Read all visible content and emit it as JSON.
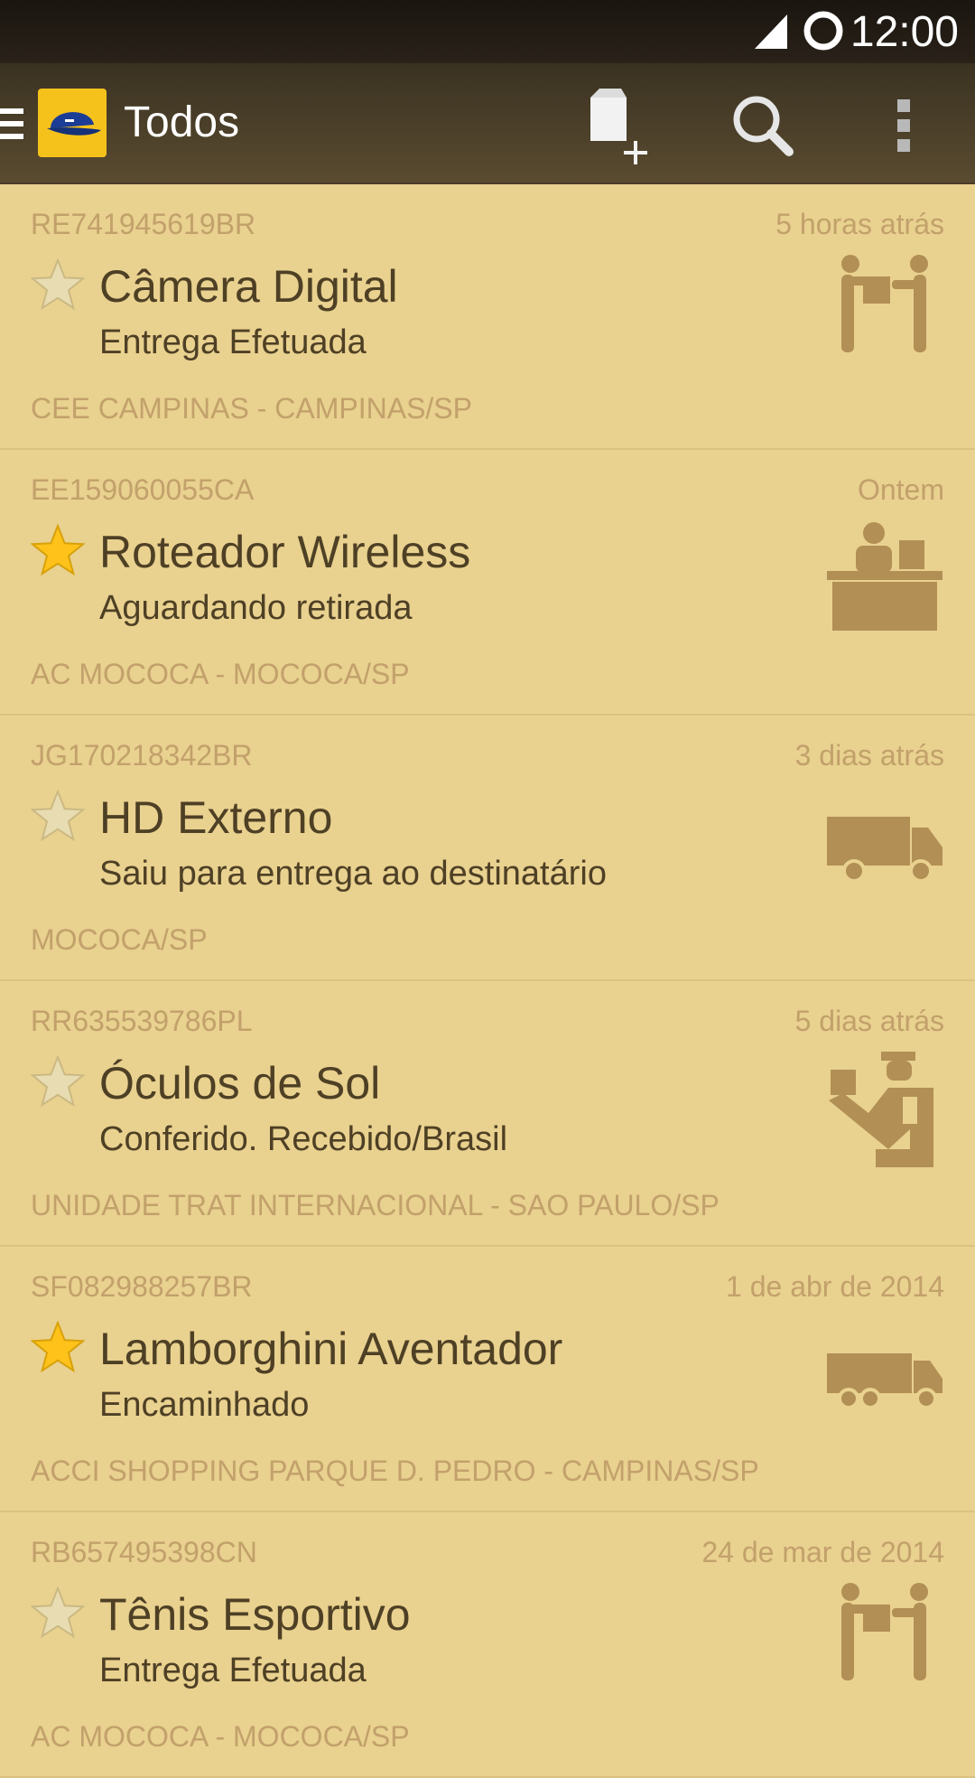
{
  "statusbar": {
    "time": "12:00"
  },
  "actionbar": {
    "title": "Todos",
    "icons": [
      "drawer-icon",
      "app-logo",
      "add-package-icon",
      "search-icon",
      "overflow-icon"
    ]
  },
  "colors": {
    "background": "#e9d18f",
    "actionbar": "#4a3d26",
    "primary_text": "#4e4025",
    "secondary_text": "#c2a16b",
    "star_active": "#ffc21a",
    "icon_fill": "#b18f55"
  },
  "items": [
    {
      "code": "RE741945619BR",
      "time": "5 horas atrás",
      "name": "Câmera Digital",
      "status": "Entrega Efetuada",
      "location": "CEE CAMPINAS - CAMPINAS/SP",
      "starred": false,
      "icon": "delivered-icon"
    },
    {
      "code": "EE159060055CA",
      "time": "Ontem",
      "name": "Roteador Wireless",
      "status": "Aguardando retirada",
      "location": "AC MOCOCA - MOCOCA/SP",
      "starred": true,
      "icon": "counter-pickup-icon"
    },
    {
      "code": "JG170218342BR",
      "time": "3 dias atrás",
      "name": "HD Externo",
      "status": "Saiu para entrega ao destinatário",
      "location": "MOCOCA/SP",
      "starred": false,
      "icon": "van-icon"
    },
    {
      "code": "RR635539786PL",
      "time": "5 dias atrás",
      "name": "Óculos de Sol",
      "status": "Conferido. Recebido/Brasil",
      "location": "UNIDADE TRAT INTERNACIONAL - SAO PAULO/SP",
      "starred": false,
      "icon": "customs-icon"
    },
    {
      "code": "SF082988257BR",
      "time": "1 de abr de 2014",
      "name": "Lamborghini Aventador",
      "status": "Encaminhado",
      "location": "ACCI SHOPPING PARQUE D. PEDRO - CAMPINAS/SP",
      "starred": true,
      "icon": "truck-icon"
    },
    {
      "code": "RB657495398CN",
      "time": "24 de mar de 2014",
      "name": "Tênis Esportivo",
      "status": "Entrega Efetuada",
      "location": "AC MOCOCA - MOCOCA/SP",
      "starred": false,
      "icon": "delivered-icon"
    }
  ]
}
